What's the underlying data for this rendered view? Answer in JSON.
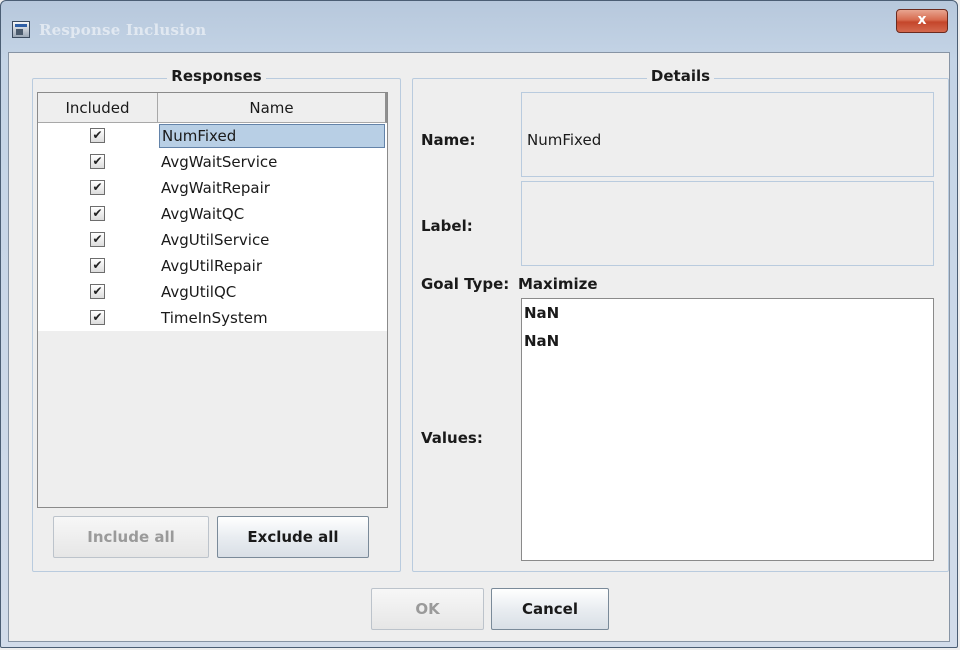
{
  "window": {
    "title": "Response Inclusion",
    "close_glyph": "x"
  },
  "responses": {
    "group_title": "Responses",
    "columns": {
      "included": "Included",
      "name": "Name"
    },
    "check_glyph": "✔",
    "rows": [
      {
        "name": "NumFixed",
        "included": true,
        "selected": true
      },
      {
        "name": "AvgWaitService",
        "included": true
      },
      {
        "name": "AvgWaitRepair",
        "included": true
      },
      {
        "name": "AvgWaitQC",
        "included": true
      },
      {
        "name": "AvgUtilService",
        "included": true
      },
      {
        "name": "AvgUtilRepair",
        "included": true
      },
      {
        "name": "AvgUtilQC",
        "included": true
      },
      {
        "name": "TimeInSystem",
        "included": true
      }
    ],
    "include_all": "Include all",
    "exclude_all": "Exclude all"
  },
  "details": {
    "group_title": "Details",
    "name_label": "Name:",
    "name_value": "NumFixed",
    "label_label": "Label:",
    "label_value": "",
    "goal_type_label": "Goal Type:",
    "goal_type_value": "Maximize",
    "values_label": "Values:",
    "values": [
      "NaN",
      "NaN"
    ]
  },
  "footer": {
    "ok": "OK",
    "cancel": "Cancel"
  }
}
